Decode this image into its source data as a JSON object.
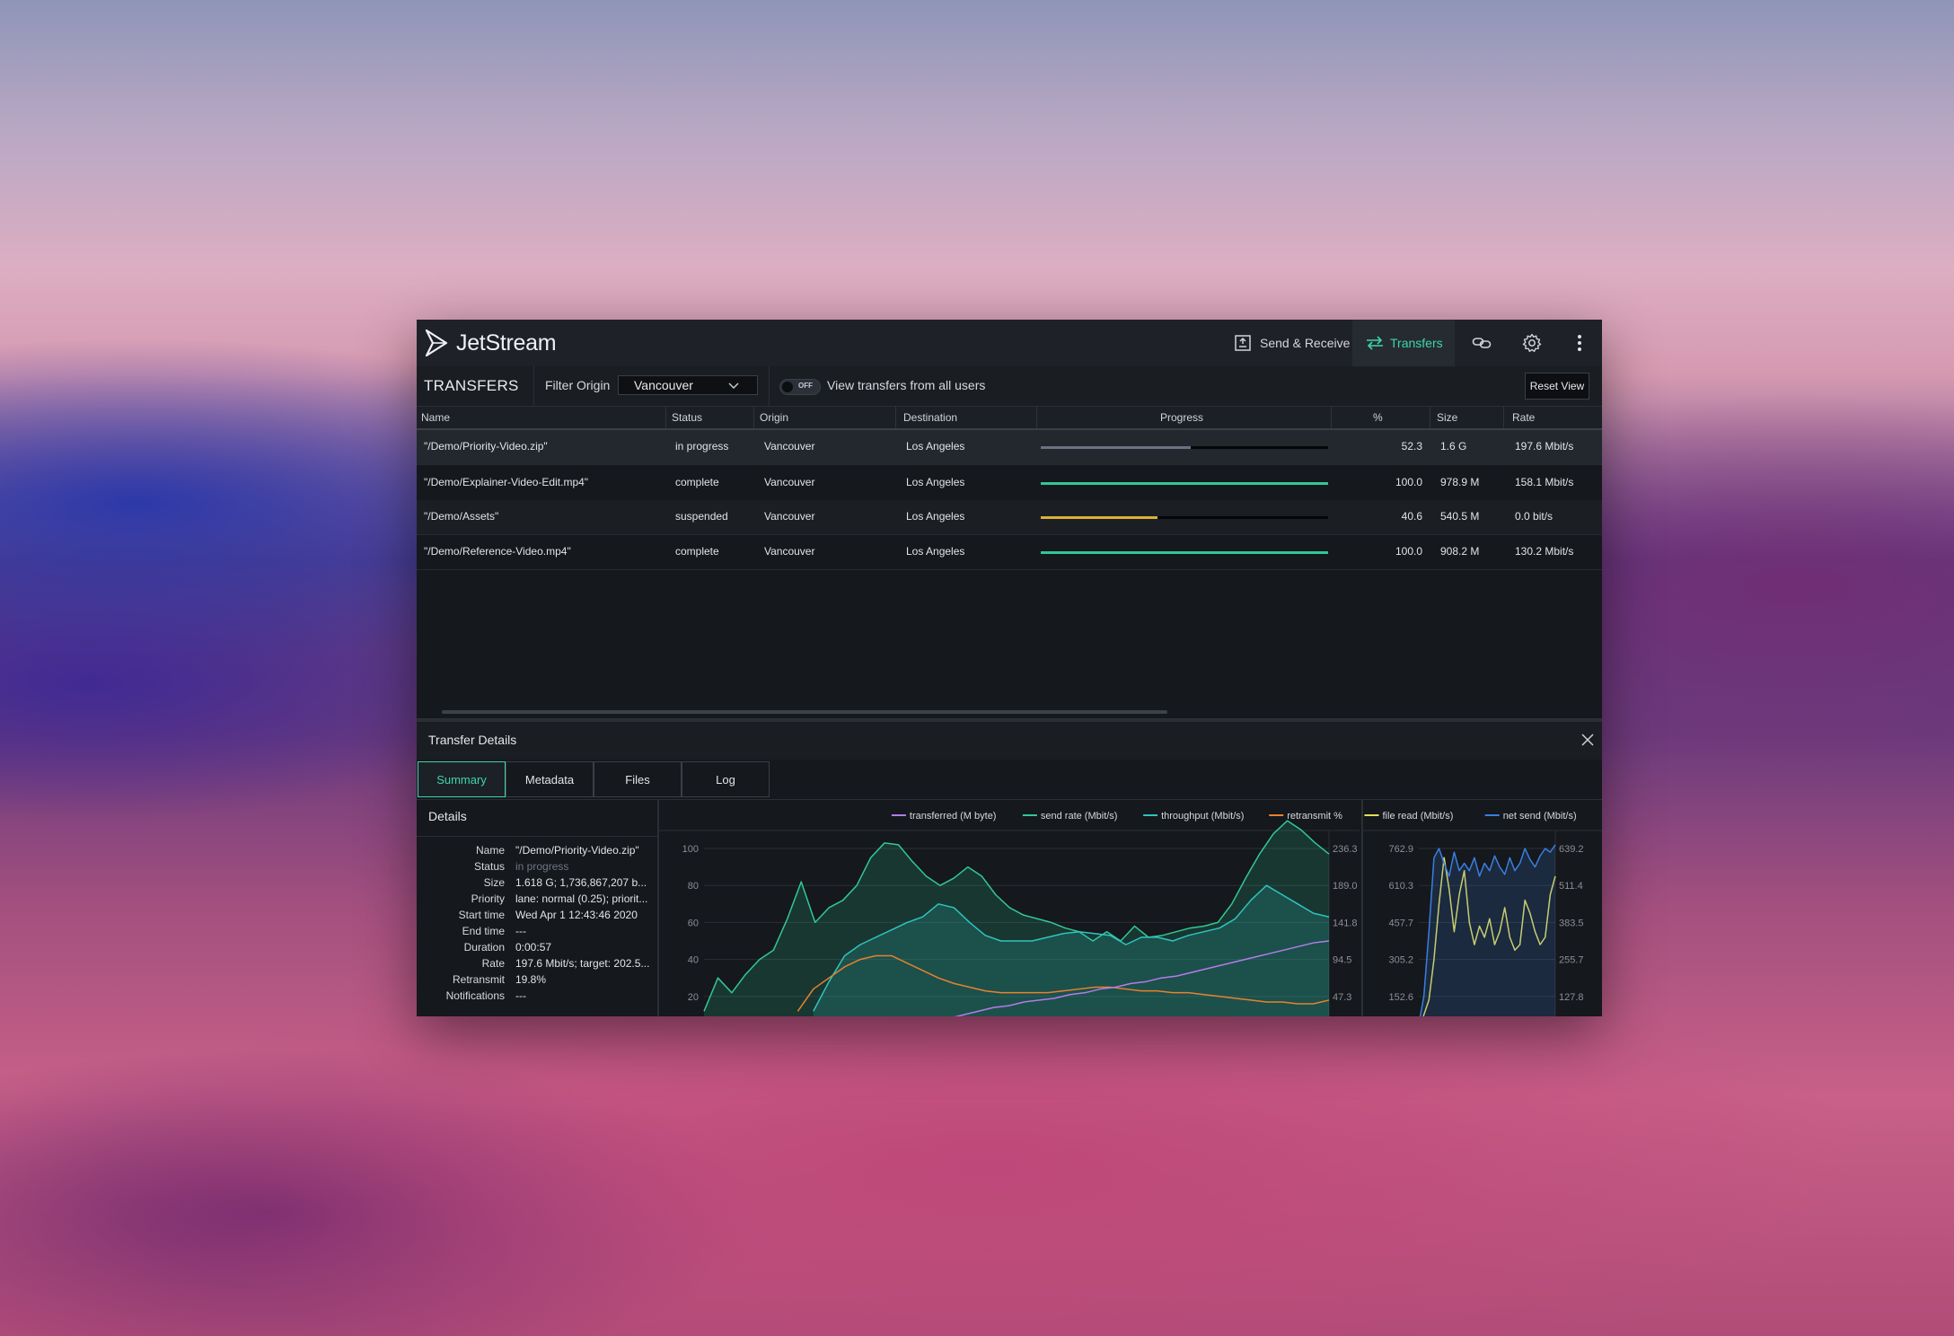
{
  "app": {
    "name": "JetStream"
  },
  "nav": {
    "send_receive": "Send & Receive",
    "transfers": "Transfers"
  },
  "toolbar": {
    "title": "TRANSFERS",
    "filter_label": "Filter Origin",
    "filter_value": "Vancouver",
    "toggle_state": "OFF",
    "view_all_label": "View transfers from all users",
    "reset_label": "Reset View"
  },
  "table": {
    "headers": [
      "Name",
      "Status",
      "Origin",
      "Destination",
      "Progress",
      "%",
      "Size",
      "Rate"
    ],
    "rows": [
      {
        "name": "\"/Demo/Priority-Video.zip\"",
        "status": "in progress",
        "origin": "Vancouver",
        "destination": "Los Angeles",
        "progress": 0.523,
        "color": "#6a7282",
        "pct": "52.3",
        "size": "1.6 G",
        "rate": "197.6 Mbit/s"
      },
      {
        "name": "\"/Demo/Explainer-Video-Edit.mp4\"",
        "status": "complete",
        "origin": "Vancouver",
        "destination": "Los Angeles",
        "progress": 1.0,
        "color": "#2fc996",
        "pct": "100.0",
        "size": "978.9 M",
        "rate": "158.1 Mbit/s"
      },
      {
        "name": "\"/Demo/Assets\"",
        "status": "suspended",
        "origin": "Vancouver",
        "destination": "Los Angeles",
        "progress": 0.406,
        "color": "#d9b13a",
        "pct": "40.6",
        "size": "540.5 M",
        "rate": "0.0 bit/s"
      },
      {
        "name": "\"/Demo/Reference-Video.mp4\"",
        "status": "complete",
        "origin": "Vancouver",
        "destination": "Los Angeles",
        "progress": 1.0,
        "color": "#2fc996",
        "pct": "100.0",
        "size": "908.2 M",
        "rate": "130.2 Mbit/s"
      }
    ]
  },
  "details_panel": {
    "title": "Transfer Details",
    "tabs": [
      "Summary",
      "Metadata",
      "Files",
      "Log"
    ],
    "active_tab": "Summary",
    "details_title": "Details",
    "fields": [
      {
        "key": "Name",
        "value": "\"/Demo/Priority-Video.zip\""
      },
      {
        "key": "Status",
        "value": "in progress"
      },
      {
        "key": "Size",
        "value": "1.618 G; 1,736,867,207 b..."
      },
      {
        "key": "Priority",
        "value": "lane: normal (0.25); priorit..."
      },
      {
        "key": "Start time",
        "value": "Wed Apr 1 12:43:46 2020"
      },
      {
        "key": "End time",
        "value": "---"
      },
      {
        "key": "Duration",
        "value": "0:00:57"
      },
      {
        "key": "Rate",
        "value": "197.6 Mbit/s; target: 202.5..."
      },
      {
        "key": "Retransmit",
        "value": "19.8%"
      },
      {
        "key": "Notifications",
        "value": "---"
      }
    ]
  },
  "colors": {
    "accent": "#3dd6a8",
    "transferred": "#b27de8",
    "send_rate": "#2fc996",
    "throughput": "#2ec4c0",
    "retransmit": "#e8822e",
    "file_read": "#e6de5a",
    "net_send": "#3a7fe0"
  },
  "chart_data": [
    {
      "type": "line",
      "legend": [
        "transferred (M byte)",
        "send rate (Mbit/s)",
        "throughput (Mbit/s)",
        "retransmit %"
      ],
      "legend_placement": "top-right",
      "left_ticks": [
        "100",
        "80",
        "60",
        "40",
        "20"
      ],
      "right_ticks": [
        "236.3",
        "189.0",
        "141.8",
        "94.5",
        "47.3"
      ],
      "ylim": [
        0,
        100
      ],
      "grid": true,
      "series": [
        {
          "name": "send rate (Mbit/s)",
          "values": [
            12,
            30,
            22,
            32,
            40,
            45,
            62,
            82,
            60,
            68,
            72,
            80,
            95,
            103,
            102,
            93,
            85,
            80,
            84,
            90,
            85,
            75,
            68,
            64,
            62,
            60,
            57,
            55,
            50,
            55,
            50,
            58,
            52,
            53,
            55,
            57,
            58,
            60,
            70,
            84,
            97,
            108,
            115,
            110,
            103,
            97
          ]
        },
        {
          "name": "throughput (Mbit/s)",
          "values": [
            null,
            null,
            null,
            null,
            null,
            null,
            null,
            12,
            28,
            42,
            48,
            52,
            56,
            60,
            63,
            70,
            68,
            60,
            53,
            50,
            50,
            50,
            52,
            54,
            55,
            54,
            53,
            48,
            52,
            52,
            50,
            53,
            55,
            57,
            62,
            72,
            80,
            75,
            70,
            65,
            63
          ]
        },
        {
          "name": "retransmit %",
          "values": [
            null,
            null,
            null,
            null,
            null,
            null,
            12,
            24,
            30,
            36,
            40,
            42,
            42,
            38,
            34,
            30,
            27,
            25,
            23,
            22,
            22,
            22,
            22,
            23,
            24,
            25,
            25,
            24,
            23,
            23,
            22,
            22,
            21,
            20,
            19,
            18,
            17,
            17,
            16,
            16,
            18
          ]
        },
        {
          "name": "transferred (M byte)",
          "values": [
            null,
            null,
            null,
            null,
            null,
            null,
            null,
            null,
            null,
            null,
            null,
            2,
            3,
            4,
            5,
            6,
            8,
            10,
            12,
            14,
            15,
            17,
            18,
            19,
            21,
            22,
            24,
            25,
            27,
            28,
            30,
            31,
            33,
            35,
            37,
            39,
            41,
            43,
            45,
            47,
            49,
            50
          ]
        }
      ]
    },
    {
      "type": "line",
      "legend": [
        "file read (Mbit/s)",
        "net send (Mbit/s)"
      ],
      "legend_placement": "top-right",
      "left_ticks": [
        "762.9",
        "610.3",
        "457.7",
        "305.2",
        "152.6"
      ],
      "right_ticks": [
        "639.2",
        "511.4",
        "383.5",
        "255.7",
        "127.8"
      ],
      "ylim": [
        0,
        100
      ],
      "grid": true,
      "series": [
        {
          "name": "file read (Mbit/s)",
          "values": [
            0,
            10,
            18,
            40,
            70,
            95,
            78,
            55,
            75,
            88,
            60,
            48,
            58,
            52,
            62,
            48,
            55,
            68,
            52,
            45,
            48,
            72,
            65,
            55,
            48,
            52,
            75,
            85
          ]
        },
        {
          "name": "net send (Mbit/s)",
          "values": [
            5,
            20,
            55,
            95,
            100,
            92,
            85,
            98,
            88,
            92,
            88,
            95,
            85,
            92,
            88,
            96,
            90,
            86,
            95,
            88,
            92,
            100,
            94,
            90,
            96,
            100,
            98,
            102
          ]
        }
      ]
    }
  ]
}
